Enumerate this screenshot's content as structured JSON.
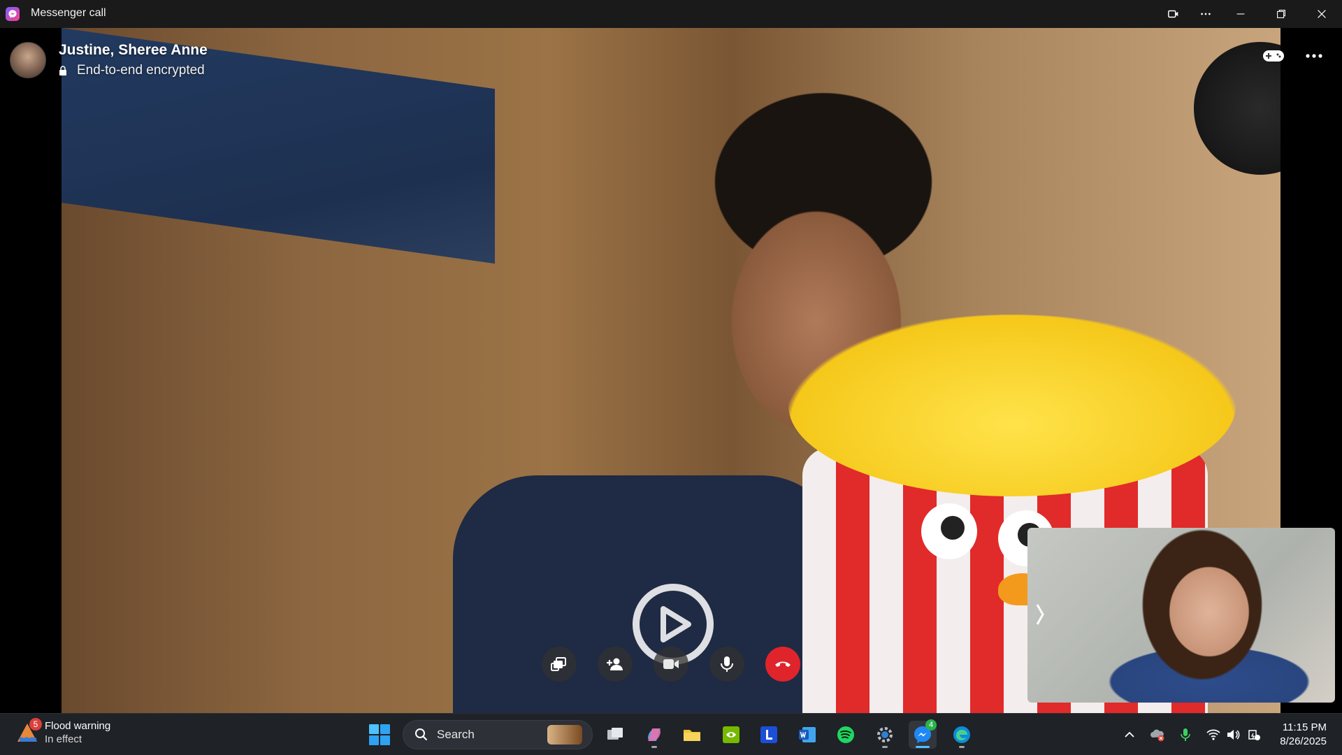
{
  "window": {
    "title": "Messenger call",
    "icon": "messenger-icon"
  },
  "call": {
    "participants": "Justine, Sheree Anne",
    "status": "End-to-end encrypted",
    "controls": [
      {
        "name": "share-screen-icon"
      },
      {
        "name": "add-person-icon"
      },
      {
        "name": "video-camera-icon"
      },
      {
        "name": "microphone-icon"
      },
      {
        "name": "end-call-icon"
      }
    ],
    "end_call_color": "#e0242b"
  },
  "taskbar": {
    "weather": {
      "badge": "5",
      "title": "Flood warning",
      "subtitle": "In effect"
    },
    "search": {
      "label": "Search"
    },
    "messenger_badge": "4",
    "clock": {
      "time": "11:15 PM",
      "date": "8/26/2025"
    },
    "apps": [
      "task-view",
      "copilot",
      "file-explorer",
      "nvidia",
      "lark",
      "word",
      "spotify",
      "settings",
      "messenger",
      "edge"
    ]
  },
  "colors": {
    "accent": "#4cc2ff",
    "taskbar_bg": "#1f2227",
    "titlebar_bg": "#1a1a1a"
  }
}
